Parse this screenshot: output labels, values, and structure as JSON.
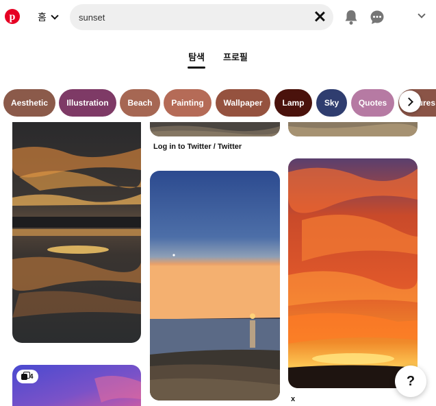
{
  "header": {
    "logo_letter": "p",
    "home_label": "홈",
    "search_value": "sunset"
  },
  "tabs": [
    {
      "label": "탐색",
      "active": true
    },
    {
      "label": "프로필",
      "active": false
    }
  ],
  "chips": [
    {
      "label": "Aesthetic",
      "color": "#8b5a4a"
    },
    {
      "label": "Illustration",
      "color": "#7e3a66"
    },
    {
      "label": "Beach",
      "color": "#a66753"
    },
    {
      "label": "Painting",
      "color": "#b56b57"
    },
    {
      "label": "Wallpaper",
      "color": "#95523f"
    },
    {
      "label": "Lamp",
      "color": "#4a120c"
    },
    {
      "label": "Sky",
      "color": "#2f3d6f"
    },
    {
      "label": "Quotes",
      "color": "#b67aa3"
    },
    {
      "label": "ures",
      "color": "#8a5447"
    }
  ],
  "pins": {
    "top_middle_title": "Log in to Twitter / Twitter",
    "right_title": "x",
    "bottom_left_count": "4"
  },
  "help_label": "?",
  "colors": {
    "brand_red": "#e60023",
    "search_bg": "#efefef"
  },
  "icons": [
    "pinterest-logo-icon",
    "chevron-down-icon",
    "clear-search-icon",
    "bell-icon",
    "chat-icon",
    "chevron-right-icon",
    "multi-image-icon",
    "help-icon"
  ]
}
